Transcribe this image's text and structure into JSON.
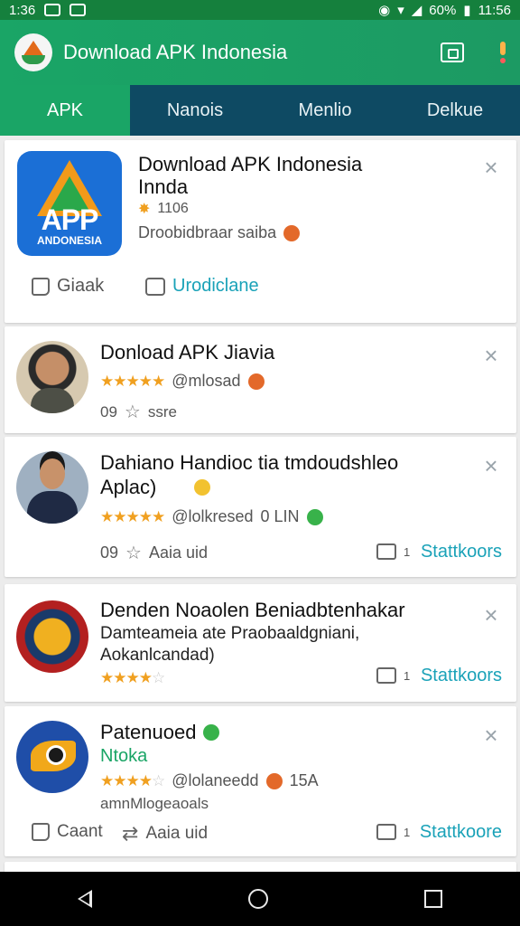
{
  "status_bar": {
    "time_left": "1:36",
    "battery": "60%",
    "time_right": "11:56"
  },
  "app_bar": {
    "title": "Download APK Indonesia"
  },
  "tabs": [
    {
      "label": "APK",
      "active": true
    },
    {
      "label": "Nanois",
      "active": false
    },
    {
      "label": "Menlio",
      "active": false
    },
    {
      "label": "Delkue",
      "active": false
    }
  ],
  "cards": [
    {
      "title_line1": "Download APK Indonesia",
      "title_line2": "Innda",
      "rating_text": "1106",
      "meta": "Droobidbraar saiba",
      "icon_text": "APP",
      "icon_subtext": "ANDONESIA",
      "action1": "Giaak",
      "action2": "Urodiclane"
    },
    {
      "title": "Donload APK Jiavia",
      "handle": "@mlosad",
      "count": "09",
      "count_label": "ssre"
    },
    {
      "title_line1": "Dahiano Handioc tia tmdoudshleo",
      "title_line2": "Aplac)",
      "handle": "@lolkresed",
      "extra": "0 LIN",
      "count": "09",
      "count_label": "Aaia uid",
      "chip": "1",
      "action": "Stattkoors"
    },
    {
      "title": "Denden Noaolen Beniadbtenhakar",
      "desc_line1": "Damteameia ate Praobaaldgniani,",
      "desc_line2": "Aokanlcandad)",
      "chip": "1",
      "action": "Stattkoors"
    },
    {
      "title": "Patenuoed",
      "subtitle": "Ntoka",
      "handle": "@lolaneedd",
      "extra": "15A",
      "meta": "amnMlogeaoals",
      "action1": "Caant",
      "action2": "Aaia uid",
      "chip": "1",
      "action": "Stattkoore"
    }
  ]
}
